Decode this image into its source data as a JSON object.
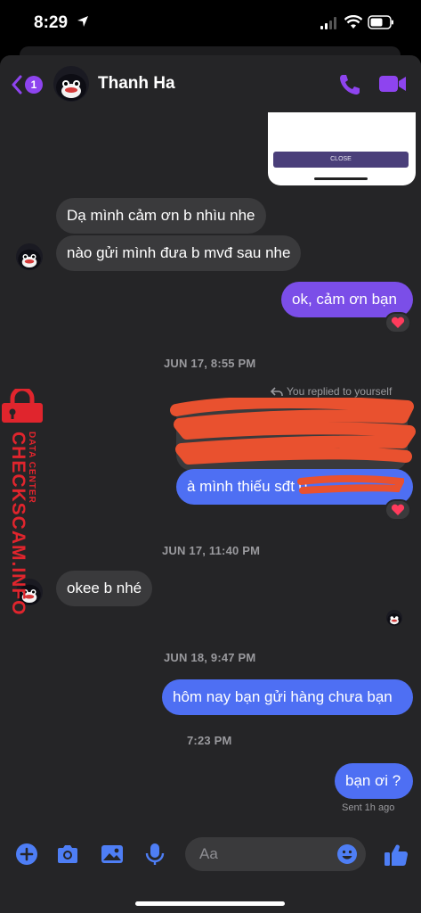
{
  "status_bar": {
    "time": "8:29"
  },
  "header": {
    "back_badge": "1",
    "contact_name": "Thanh Ha"
  },
  "shared_screenshot": {
    "close_label": "CLOSE"
  },
  "messages": [
    {
      "side": "recv",
      "text": "Dạ mình cảm ơn b nhìu nhe"
    },
    {
      "side": "recv",
      "text": "nào gửi mình đưa b mvđ sau nhe"
    },
    {
      "side": "sent",
      "text": "ok, cảm ơn bạn",
      "reaction": "heart"
    },
    {
      "timestamp": "JUN 17, 8:55 PM"
    },
    {
      "replied_label": "You replied to yourself"
    },
    {
      "side": "sent",
      "text": "à mình thiếu sđt 0",
      "redacted": true,
      "reaction": "heart"
    },
    {
      "timestamp": "JUN 17, 11:40 PM"
    },
    {
      "side": "recv",
      "text": "okee b nhé"
    },
    {
      "timestamp": "JUN 18, 9:47 PM"
    },
    {
      "side": "sent",
      "text": "hôm nay bạn gửi hàng chưa bạn"
    },
    {
      "timestamp": "7:23 PM"
    },
    {
      "side": "sent",
      "text": "bạn ơi ?"
    }
  ],
  "sent_status": "Sent 1h ago",
  "composer": {
    "placeholder": "Aa"
  },
  "watermark": {
    "main": "CHECKSCAM.INFO",
    "sub": "DATA CENTER"
  },
  "colors": {
    "accent": "#8e44ef",
    "sent_purple": "#7b4ee8",
    "sent_blue": "#4e6ff3",
    "watermark": "#e0252d"
  }
}
